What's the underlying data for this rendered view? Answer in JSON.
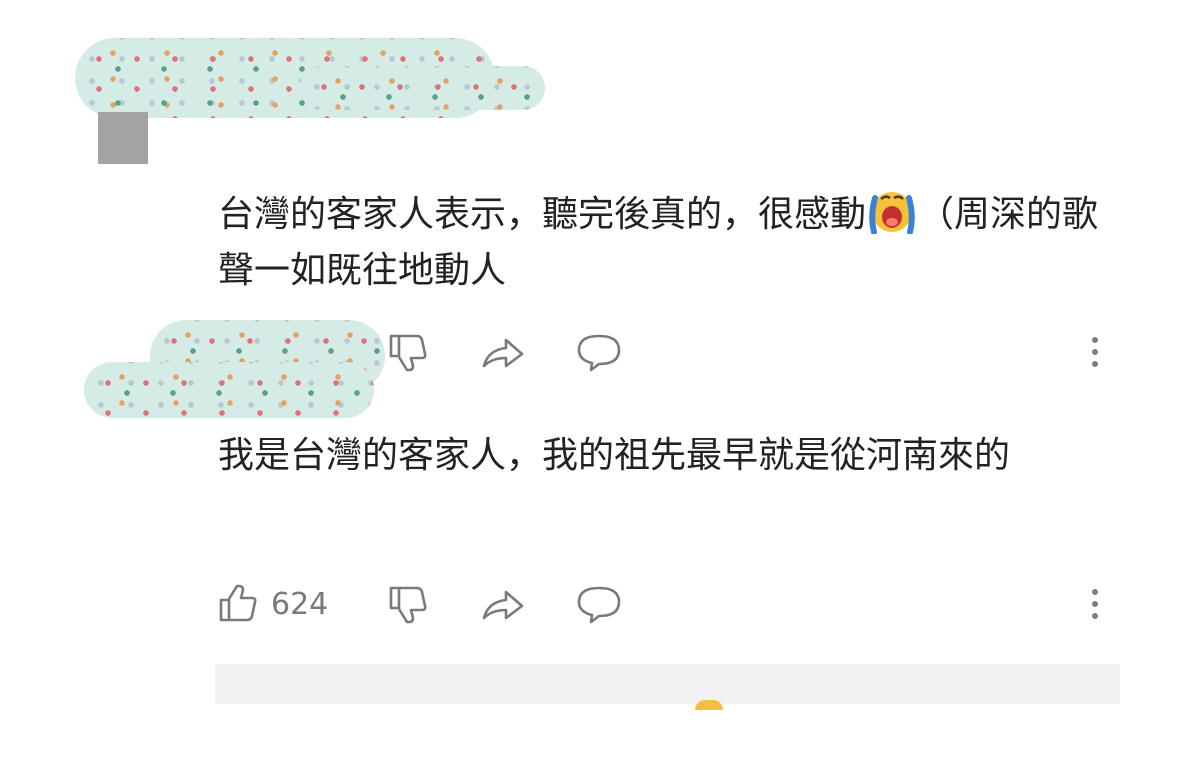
{
  "comments": [
    {
      "text_before_emoji": "台灣的客家人表示，聽完後真的，很感動",
      "text_after_emoji": "（周深的歌聲一如既往地動人",
      "emoji": "loudly-crying-face"
    },
    {
      "text": "我是台灣的客家人，我的祖先最早就是從河南來的",
      "like_count": "624"
    }
  ],
  "icons": [
    "thumbs-up-icon",
    "thumbs-down-icon",
    "share-icon",
    "reply-icon",
    "more-options-icon"
  ],
  "colors": {
    "icon": "#7a7a7a",
    "text": "#222222",
    "redaction_bg": "#d4ebe6"
  }
}
